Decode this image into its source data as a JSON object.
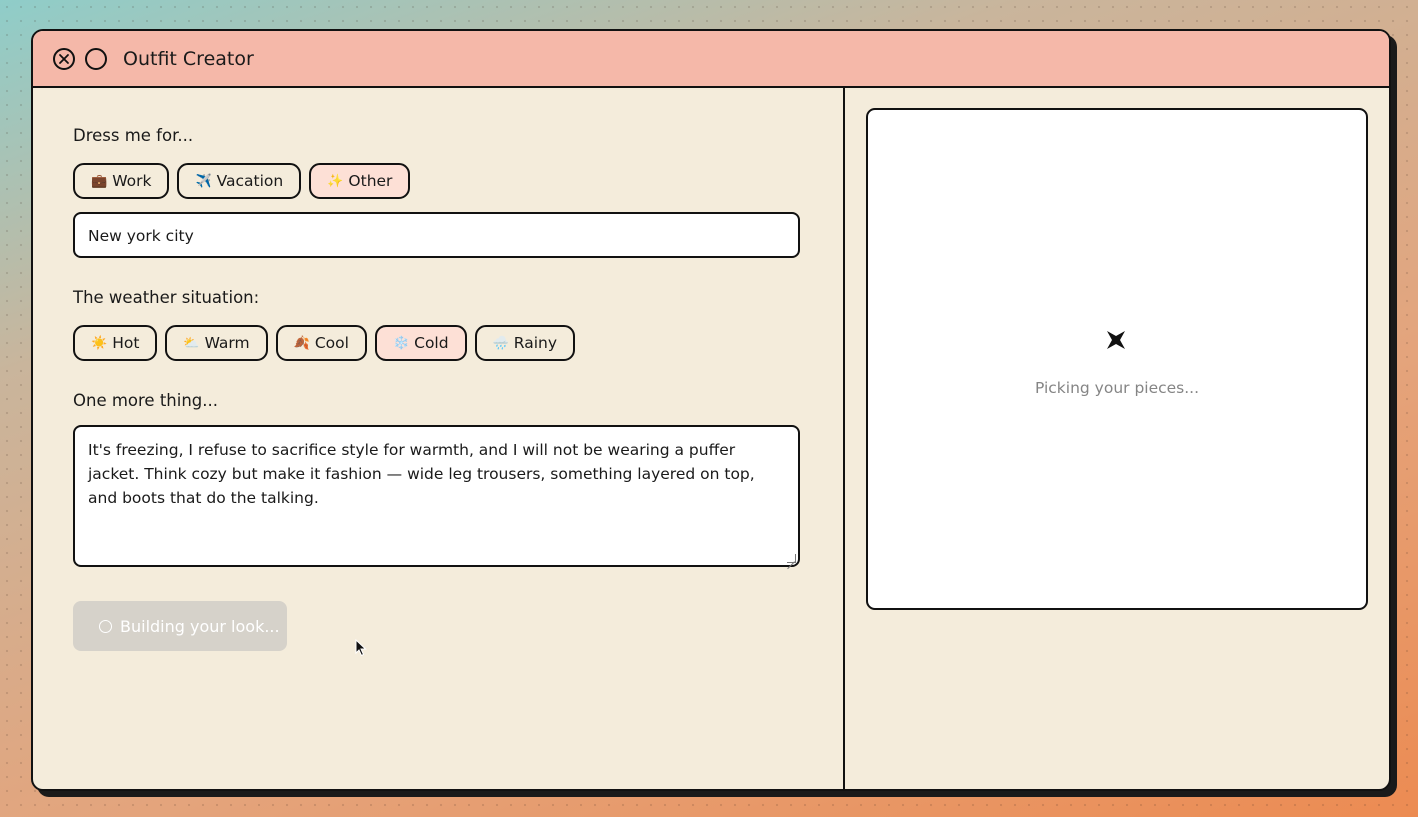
{
  "window": {
    "title": "Outfit Creator",
    "close_icon": "close-circle-icon",
    "minimize_icon": "circle-icon"
  },
  "occasion": {
    "label": "Dress me for...",
    "options": [
      {
        "emoji": "💼",
        "label": "Work",
        "selected": false
      },
      {
        "emoji": "✈️",
        "label": "Vacation",
        "selected": false
      },
      {
        "emoji": "✨",
        "label": "Other",
        "selected": true
      }
    ],
    "custom_value": "New york city"
  },
  "weather": {
    "label": "The weather situation:",
    "options": [
      {
        "emoji": "☀️",
        "label": "Hot",
        "selected": false
      },
      {
        "emoji": "⛅",
        "label": "Warm",
        "selected": false
      },
      {
        "emoji": "🍂",
        "label": "Cool",
        "selected": false
      },
      {
        "emoji": "❄️",
        "label": "Cold",
        "selected": true
      },
      {
        "emoji": "🌧️",
        "label": "Rainy",
        "selected": false
      }
    ]
  },
  "notes": {
    "label": "One more thing...",
    "value": "It's freezing, I refuse to sacrifice style for warmth, and I will not be wearing a puffer jacket. Think cozy but make it fashion — wide leg trousers, something layered on top, and boots that do the talking."
  },
  "build_button": {
    "label": "Building your look...",
    "state": "loading"
  },
  "preview": {
    "status": "Picking your pieces...",
    "icon": "sparkle-icon"
  },
  "colors": {
    "titlebar": "#f5b8a9",
    "panel": "#f4ecdb",
    "selected_chip": "#fde0d6",
    "disabled_button": "#d6d2ca"
  }
}
